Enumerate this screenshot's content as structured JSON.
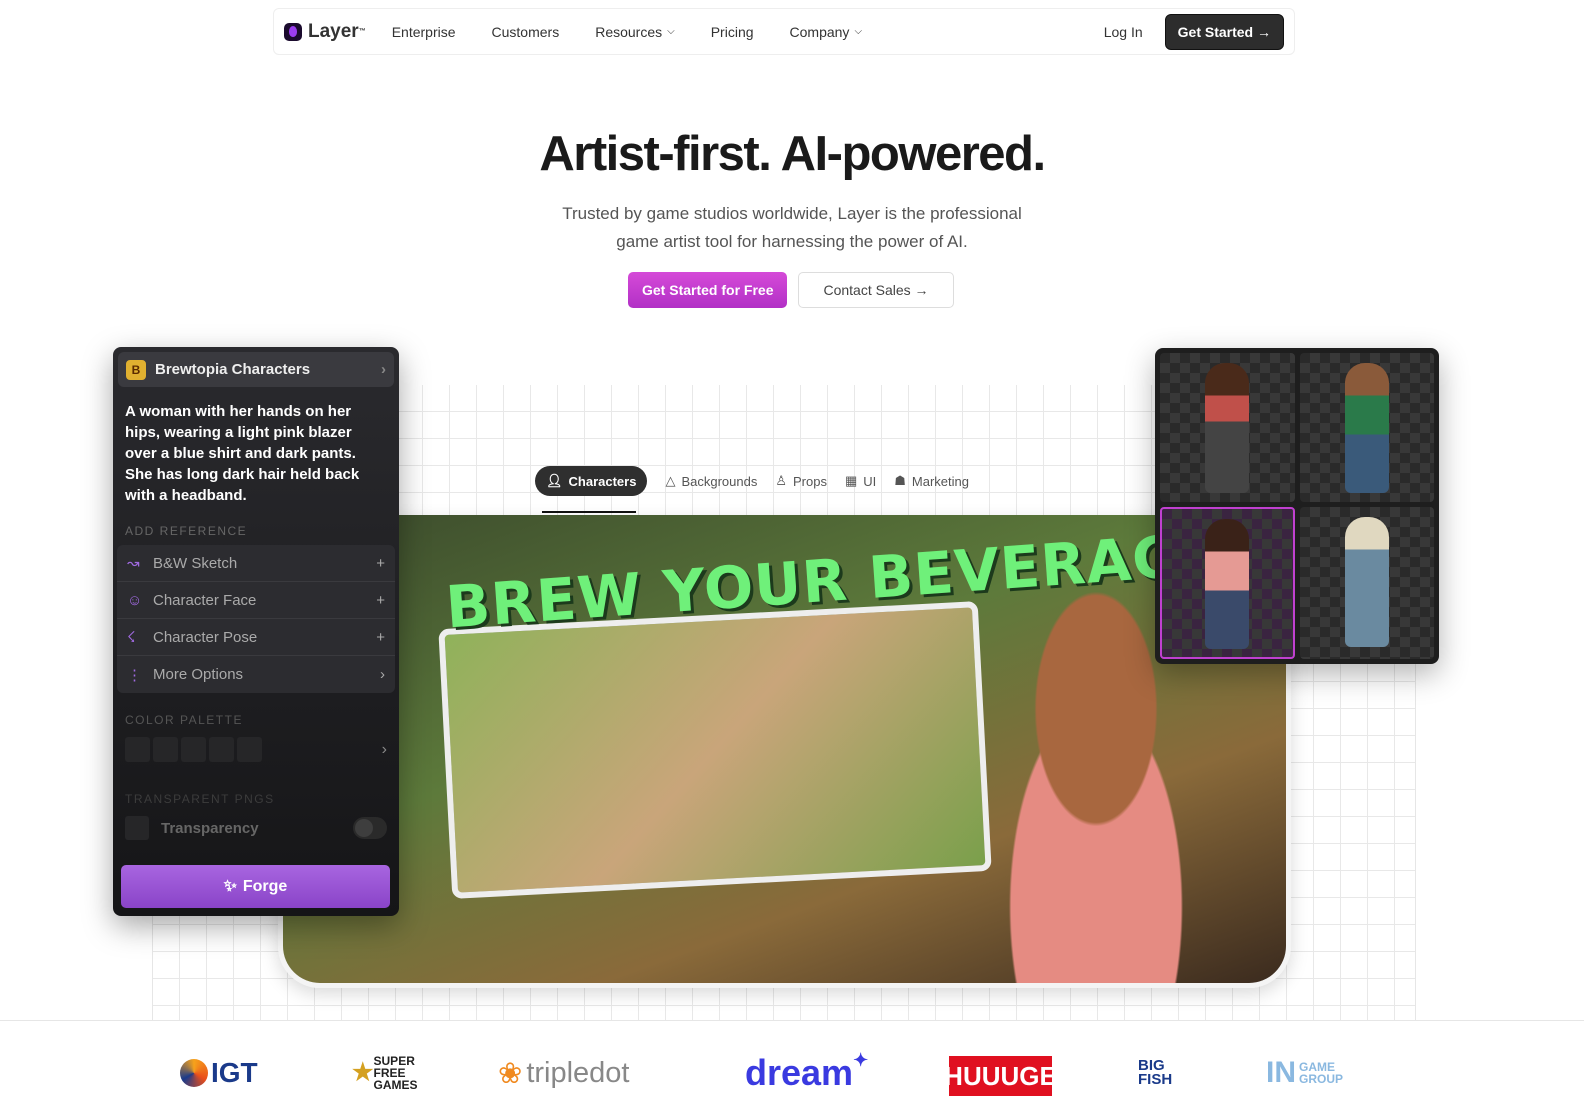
{
  "nav": {
    "logo": "Layer",
    "tm": "™",
    "links": [
      "Enterprise",
      "Customers",
      "Resources",
      "Pricing",
      "Company"
    ],
    "login": "Log In",
    "get_started": "Get Started →"
  },
  "hero": {
    "title": "Artist-first. AI-powered.",
    "subtitle_1": "Trusted by game studios worldwide, Layer is the professional",
    "subtitle_2": "game artist tool for harnessing the power of AI.",
    "primary_cta": "Get Started for Free",
    "secondary_cta": "Contact Sales →"
  },
  "tabs": [
    {
      "label": "Characters",
      "icon": "user-icon"
    },
    {
      "label": "Backgrounds",
      "icon": "mountain-icon"
    },
    {
      "label": "Props",
      "icon": "user-icon"
    },
    {
      "label": "UI",
      "icon": "layout-icon"
    },
    {
      "label": "Marketing",
      "icon": "store-icon"
    }
  ],
  "showcase": {
    "game_title": "BREW YOUR BEVERAGES"
  },
  "panel": {
    "project": "Brewtopia Characters",
    "prompt": "A woman with her hands on her hips, wearing a light pink blazer over a blue shirt and dark pants. She has long dark hair held back with a headband.",
    "add_reference": "ADD REFERENCE",
    "references": [
      {
        "label": "B&W Sketch",
        "icon": "sketch-icon",
        "action": "+"
      },
      {
        "label": "Character Face",
        "icon": "face-icon",
        "action": "+"
      },
      {
        "label": "Character Pose",
        "icon": "running-icon",
        "action": "+"
      },
      {
        "label": "More Options",
        "icon": "more-vertical-icon",
        "action": "›"
      }
    ],
    "color_palette": "COLOR PALETTE",
    "transparent_pngs": "TRANSPARENT PNGS",
    "transparency": "Transparency",
    "transparency_on": false,
    "forge": "Forge"
  },
  "logos": [
    "IGT",
    "SUPER FREE GAMES",
    "tripledot",
    "dream",
    "HUUUGE",
    "BIG FISH",
    "GAME GROUP"
  ],
  "colors": {
    "accent": "#b230c6",
    "forge": "#9a55d6",
    "dark": "#2d2d2d"
  }
}
